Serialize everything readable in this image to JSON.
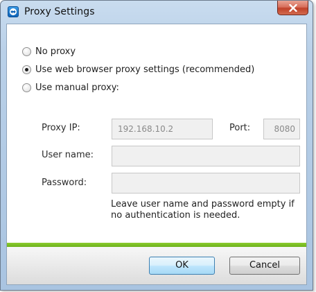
{
  "window": {
    "title": "Proxy Settings"
  },
  "icons": {
    "app": "teamviewer-icon",
    "close": "close-icon"
  },
  "options": [
    {
      "label": "No proxy",
      "checked": false
    },
    {
      "label": "Use web browser proxy settings (recommended)",
      "checked": true
    },
    {
      "label": "Use manual proxy:",
      "checked": false
    }
  ],
  "proxy": {
    "ip_label": "Proxy IP:",
    "ip_value": "192.168.10.2",
    "port_label": "Port:",
    "port_value": "8080",
    "username_label": "User name:",
    "username_value": "",
    "password_label": "Password:",
    "password_value": ""
  },
  "hint": "Leave user name and password empty if no authentication is needed.",
  "buttons": {
    "ok": "OK",
    "cancel": "Cancel"
  },
  "colors": {
    "accent_bar": "#7cbf27",
    "close_button": "#c9503a"
  }
}
